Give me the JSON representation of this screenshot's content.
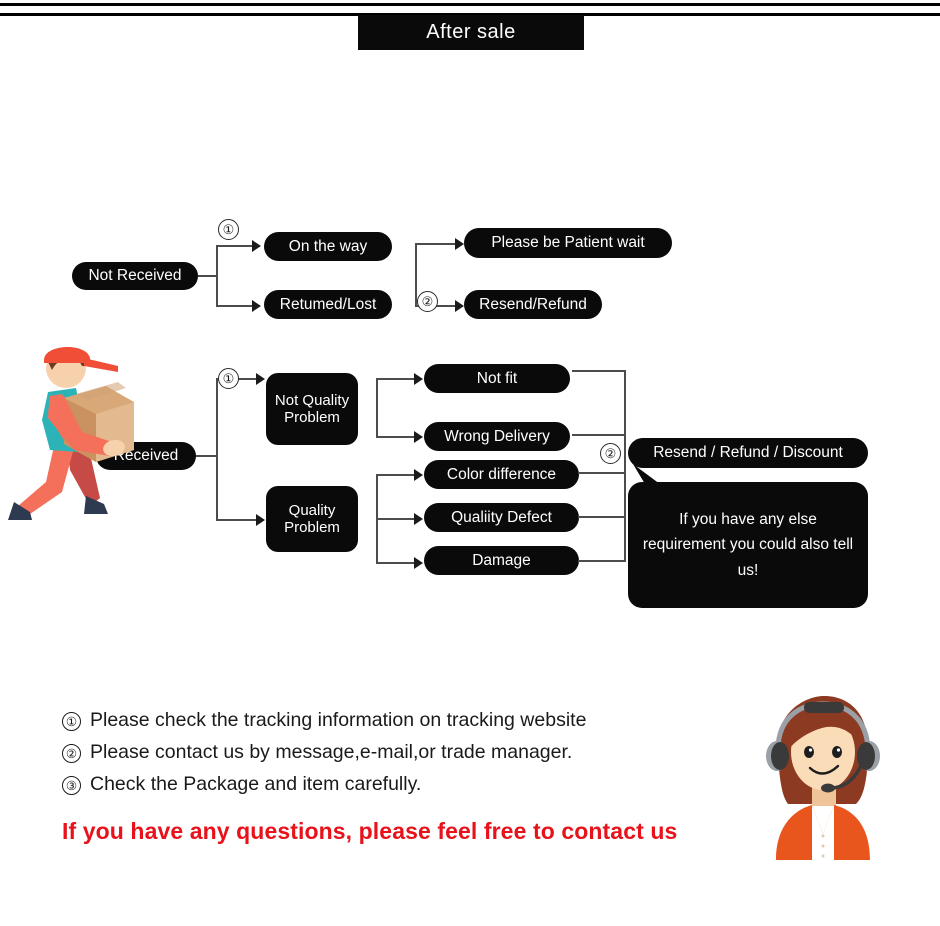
{
  "header": {
    "title": "After sale"
  },
  "flow_not_received": {
    "root": "Not Received",
    "marker_1": "①",
    "marker_2": "②",
    "branches": [
      "On the way",
      "Retumed/Lost"
    ],
    "outcomes": [
      "Please be Patient wait",
      "Resend/Refund"
    ]
  },
  "flow_received": {
    "root": "Received",
    "marker_1": "①",
    "marker_2": "②",
    "categories": [
      "Not\nQuality\nProblem",
      "Quality\nProblem"
    ],
    "category_not_quality": "Not Quality Problem",
    "category_quality": "Quality Problem",
    "not_quality_reasons": [
      "Not fit",
      "Wrong Delivery"
    ],
    "quality_reasons": [
      "Color difference",
      "Qualiity Defect",
      "Damage"
    ],
    "outcome": "Resend / Refund / Discount",
    "bubble": "If you have any else requirement you could also tell us!"
  },
  "notes": {
    "items": [
      {
        "num": "①",
        "text": "Please check the tracking information on tracking website"
      },
      {
        "num": "②",
        "text": "Please contact us by message,e-mail,or trade manager."
      },
      {
        "num": "③",
        "text": "Check the Package and item carefully."
      }
    ],
    "highlight": "If you have any questions, please feel free to contact us"
  },
  "colors": {
    "box": "#0a0a0a",
    "line": "#4c4c4c",
    "highlight_red": "#e8121a",
    "courier_cap": "#f04e37",
    "courier_shirt": "#2bb3b8",
    "courier_limbs": "#f4705a",
    "courier_leg_back": "#c64a45",
    "parcel": "#d9a878",
    "skin": "#f7d1ab",
    "agent_hair": "#8c3b22",
    "agent_top": "#e8561e",
    "headset": "#3a3a3a"
  },
  "illustrations": {
    "courier": "delivery-man-carrying-parcel",
    "agent": "customer-service-agent-with-headset"
  }
}
